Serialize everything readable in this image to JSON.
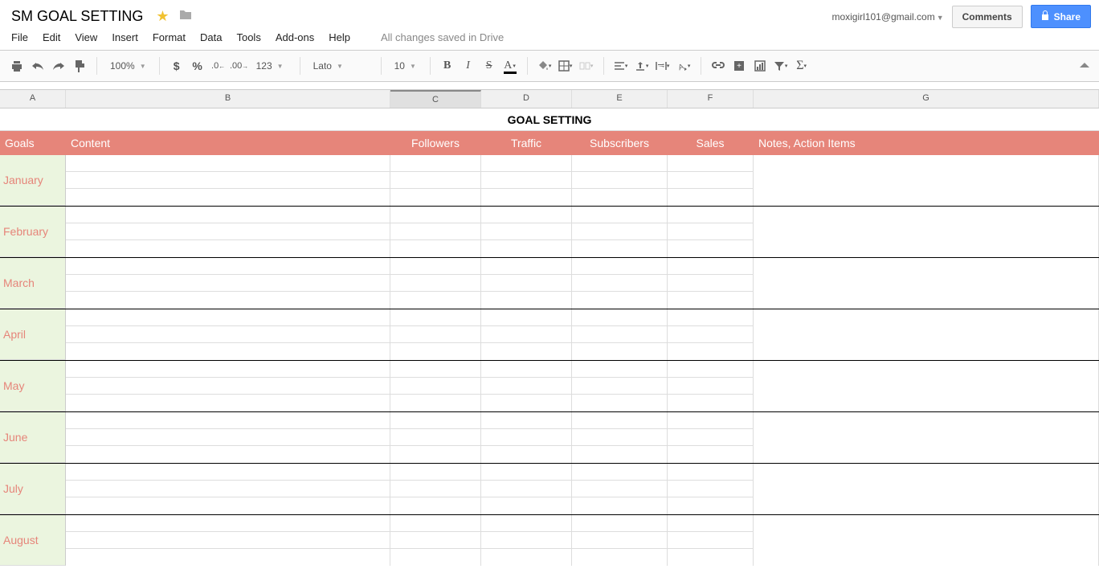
{
  "header": {
    "doc_title": "SM GOAL SETTING",
    "account_email": "moxigirl101@gmail.com",
    "comments_label": "Comments",
    "share_label": "Share",
    "save_status": "All changes saved in Drive"
  },
  "menu": {
    "items": [
      "File",
      "Edit",
      "View",
      "Insert",
      "Format",
      "Data",
      "Tools",
      "Add-ons",
      "Help"
    ]
  },
  "toolbar": {
    "zoom": "100%",
    "font": "Lato",
    "font_size": "10",
    "number_format_label": "123"
  },
  "columns": [
    "A",
    "B",
    "C",
    "D",
    "E",
    "F",
    "G"
  ],
  "selected_column": "C",
  "sheet": {
    "title": "GOAL SETTING",
    "headers": [
      "Goals",
      "Content",
      "Followers",
      "Traffic",
      "Subscribers",
      "Sales",
      "Notes, Action Items"
    ],
    "months": [
      "January",
      "February",
      "March",
      "April",
      "May",
      "June",
      "July",
      "August"
    ]
  }
}
